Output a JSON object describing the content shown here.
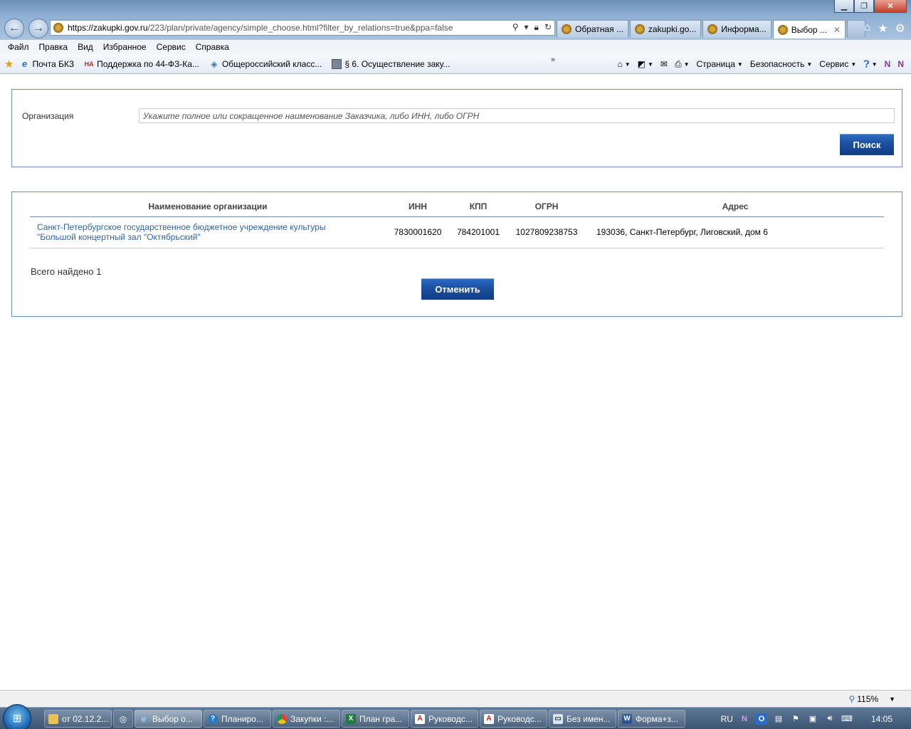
{
  "browser": {
    "address": {
      "url_main": "https://zakupki.gov.ru",
      "url_rest": "/223/plan/private/agency/simple_choose.html?filter_by_relations=true&ppa=false"
    },
    "tabs": [
      {
        "label": "Обратная ..."
      },
      {
        "label": "zakupki.go..."
      },
      {
        "label": "Информа..."
      },
      {
        "label": "Выбор ..."
      }
    ],
    "menu": [
      "Файл",
      "Правка",
      "Вид",
      "Избранное",
      "Сервис",
      "Справка"
    ],
    "favorites": [
      {
        "label": "Почта БКЗ"
      },
      {
        "label": "Поддержка по 44-ФЗ-Ка..."
      },
      {
        "label": "Общероссийский класс..."
      },
      {
        "label": "§ 6. Осуществление заку..."
      }
    ],
    "commands": {
      "page": "Страница",
      "security": "Безопасность",
      "service": "Сервис"
    },
    "zoom": "115%"
  },
  "page": {
    "search": {
      "org_label": "Организация",
      "org_placeholder": "Укажите полное или сокращенное наименование Заказчика, либо ИНН, либо ОГРН",
      "org_value": "",
      "search_button": "Поиск"
    },
    "table": {
      "headers": {
        "name": "Наименование организации",
        "inn": "ИНН",
        "kpp": "КПП",
        "ogrn": "ОГРН",
        "address": "Адрес"
      },
      "rows": [
        {
          "name_line1": "Санкт-Петербургское государственное бюджетное учреждение культуры",
          "name_line2": "\"Большой концертный зал \"Октябрьский\"",
          "inn": "7830001620",
          "kpp": "784201001",
          "ogrn": "1027809238753",
          "address": "193036, Санкт-Петербург, Лиговский, дом 6"
        }
      ]
    },
    "total": "Всего найдено 1",
    "cancel_button": "Отменить"
  },
  "taskbar": {
    "items": [
      {
        "label": "от 02.12.2...",
        "icon": "folder"
      },
      {
        "label": "Выбор о...",
        "icon": "ie",
        "active": true
      },
      {
        "label": "Планиро...",
        "icon": "help"
      },
      {
        "label": "Закупки :...",
        "icon": "chrome"
      },
      {
        "label": "План гра...",
        "icon": "excel"
      },
      {
        "label": "Руководс...",
        "icon": "pdf"
      },
      {
        "label": "Руководс...",
        "icon": "pdf"
      },
      {
        "label": "Без имен...",
        "icon": "paint"
      },
      {
        "label": "Форма+з...",
        "icon": "word"
      }
    ],
    "lang": "RU",
    "clock": "14:05"
  },
  "colors": {
    "accent_button": "#1a4e9c",
    "panel_border": "#6d8fb3",
    "link": "#2e64a8"
  }
}
